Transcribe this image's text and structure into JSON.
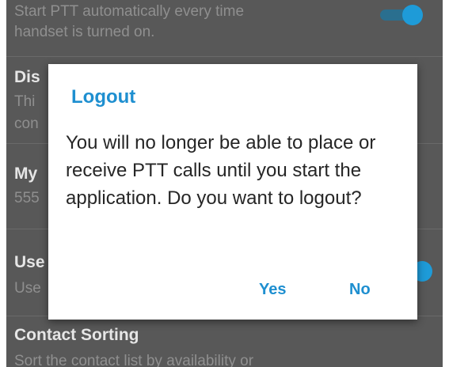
{
  "settings": {
    "autostart": {
      "desc": "Start PTT automatically every time\nhandset is turned on."
    },
    "display": {
      "title": "Dis",
      "desc_line1": "Thi",
      "desc_line2": "con"
    },
    "my_number": {
      "title": "My",
      "desc": "555"
    },
    "use": {
      "title": "Use",
      "desc": "Use"
    },
    "contact_sorting": {
      "title": "Contact Sorting",
      "desc": "Sort the contact list by availability or"
    }
  },
  "dialog": {
    "title": "Logout",
    "message": "You will no longer be able to place or receive PTT calls until you start the application. Do you want to logout?",
    "yes_label": "Yes",
    "no_label": "No"
  },
  "colors": {
    "accent": "#1e8fd0",
    "background": "#585858"
  }
}
